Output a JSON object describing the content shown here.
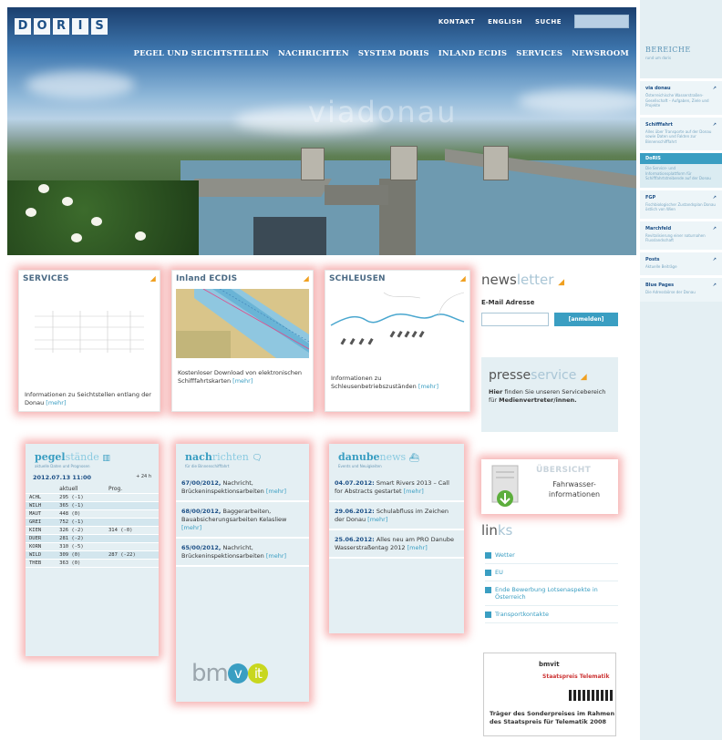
{
  "header": {
    "logo_letters": [
      "D",
      "O",
      "R",
      "I",
      "S"
    ],
    "top_links": [
      "KONTAKT",
      "ENGLISH",
      "SUCHE"
    ],
    "search_placeholder": "",
    "nav": [
      "PEGEL UND SEICHTSTELLEN",
      "NACHRICHTEN",
      "SYSTEM DORIS",
      "INLAND ECDIS",
      "SERVICES",
      "NEWSROOM"
    ],
    "watermark": "viadonau"
  },
  "sidebar": {
    "title": "BEREICHE",
    "subtitle": "rund um doris",
    "items": [
      {
        "title": "via donau",
        "text": "Österreichische Wasserstraßen-Gesellschaft – Aufgaben, Ziele und Projekte",
        "active": false
      },
      {
        "title": "Schifffahrt",
        "text": "Alles über Transporte auf der Donau sowie Daten und Fakten zur Binnenschifffahrt",
        "active": false
      },
      {
        "title": "DoRIS",
        "text": "Die Service- und Informationsplattform für Schifffahrtstreibende auf der Donau",
        "active": true
      },
      {
        "title": "FGP",
        "text": "Fischbiologischer Zustandsplan Donau östlich von Wien",
        "active": false
      },
      {
        "title": "Marchfeld",
        "text": "Revitalisierung einer naturnahen Flusslandschaft",
        "active": false
      },
      {
        "title": "Posts",
        "text": "Aktuelle Beiträge",
        "active": false
      },
      {
        "title": "Blue Pages",
        "text": "Die Adressbörse der Donau",
        "active": false
      }
    ]
  },
  "cards": [
    {
      "title": "SERVICES",
      "text": "Informationen zu Seichtstellen entlang der Donau",
      "more": "[mehr]"
    },
    {
      "title": "Inland ECDIS",
      "text": "Kostenloser Download von elektronischen Schifffahrtskarten",
      "more": "[mehr]"
    },
    {
      "title": "SCHLEUSEN",
      "text": "Informationen zu Schleusenbetriebszuständen",
      "more": "[mehr]"
    }
  ],
  "pegel": {
    "logo_bold": "pegel",
    "logo_light": "stände",
    "subtitle": "aktuelle Daten und Prognosen",
    "date": "2012.07.13 11:00",
    "forecast_hint": "+ 24 h",
    "headers": [
      "",
      "aktuell",
      "Prog."
    ],
    "rows": [
      [
        "ACHL",
        "295 (-1)",
        ""
      ],
      [
        "WILH",
        "365 (-1)",
        ""
      ],
      [
        "MAUT",
        "448 (0)",
        ""
      ],
      [
        "GREI",
        "752 (-1)",
        ""
      ],
      [
        "KIEN",
        "326 (-2)",
        "314 (-0)"
      ],
      [
        "DUER",
        "281 (-2)",
        ""
      ],
      [
        "KORN",
        "310 (-5)",
        ""
      ],
      [
        "WILD",
        "309 (0)",
        "287 (-22)"
      ],
      [
        "THEB",
        "363 (0)",
        ""
      ]
    ]
  },
  "nachrichten": {
    "logo_bold": "nach",
    "logo_light": "richten",
    "subtitle": "für die Binnenschifffahrt",
    "items": [
      {
        "title": "67/00/2012,",
        "text": "Nachricht, Brückeninspektionsarbeiten",
        "more": "[mehr]"
      },
      {
        "title": "68/00/2012,",
        "text": "Baggerarbeiten, Bauabsicherungsarbeiten Kelasliew",
        "more": "[mehr]"
      },
      {
        "title": "65/00/2012,",
        "text": "Nachricht, Brückeninspektionsarbeiten",
        "more": "[mehr]"
      }
    ]
  },
  "danubenews": {
    "logo_bold": "danube",
    "logo_light": "news",
    "subtitle": "Events und Neuigkeiten",
    "items": [
      {
        "title": "04.07.2012:",
        "text": "Smart Rivers 2013 – Call for Abstracts gestartet",
        "more": "[mehr]"
      },
      {
        "title": "29.06.2012:",
        "text": "Schulabfluss im Zeichen der Donau",
        "more": "[mehr]"
      },
      {
        "title": "25.06.2012:",
        "text": "Alles neu am PRO Danube Wasserstraßentag 2012",
        "more": "[mehr]"
      }
    ]
  },
  "newsletter": {
    "title_dark": "news",
    "title_light": "letter",
    "label": "E-Mail Adresse",
    "button": "[anmelden]"
  },
  "presse": {
    "title_dark": "presse",
    "title_light": "service",
    "text_lead": "Hier",
    "text": "finden Sie unseren Servicebereich für",
    "text_bold": "Medienvertreter/innen."
  },
  "fahrwasser": {
    "heading": "ÜBERSICHT",
    "line1": "Fahrwasser-",
    "line2": "informationen"
  },
  "links": {
    "title_dark": "lin",
    "title_light": "ks",
    "items": [
      "Wetter",
      "EU",
      "Ende Bewerbung Lotsenaspekte in Österreich",
      "Transportkontakte"
    ]
  },
  "award": {
    "logo": "bmvit",
    "flag": "Staatspreis Telematik",
    "text": "Träger des Sonderpreises im Rahmen des Staatspreis für Telematik 2008"
  },
  "sponsor": {
    "text_a": "bm",
    "text_v": "v",
    "text_it": "it"
  }
}
